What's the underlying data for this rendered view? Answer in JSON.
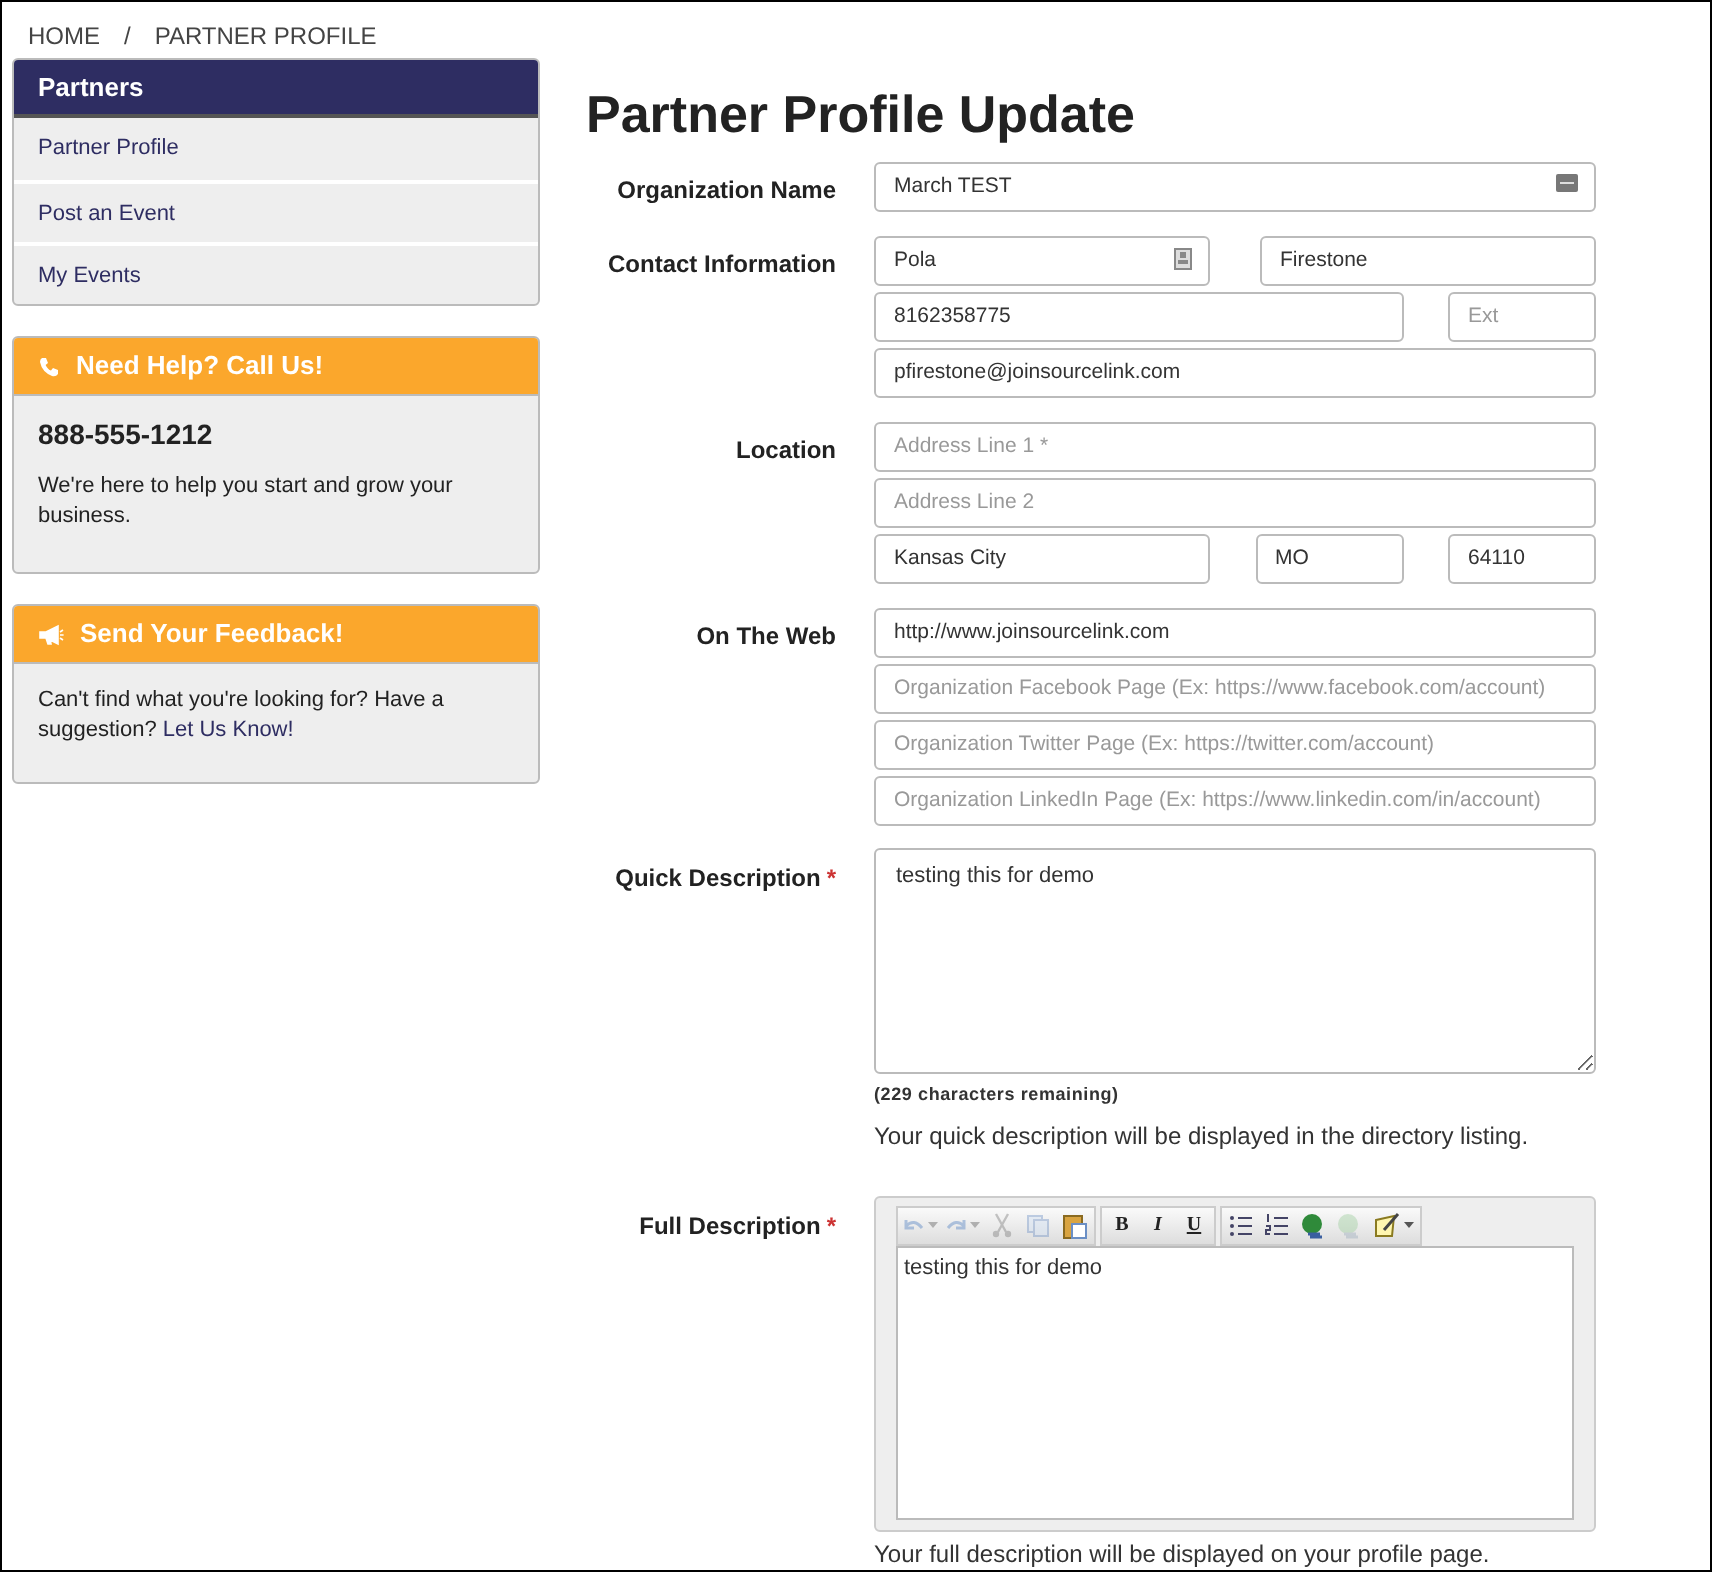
{
  "breadcrumb": {
    "separator": "/",
    "items": [
      "HOME",
      "PARTNER PROFILE"
    ]
  },
  "sidebar": {
    "title": "Partners",
    "items": [
      {
        "label": "Partner Profile"
      },
      {
        "label": "Post an Event"
      },
      {
        "label": "My Events"
      }
    ]
  },
  "help_panel": {
    "title": "Need Help? Call Us!",
    "phone": "888-555-1212",
    "text": "We're here to help you start and grow your business."
  },
  "feedback_panel": {
    "title": "Send Your Feedback!",
    "text": "Can't find what you're looking for? Have a suggestion?",
    "link": "Let Us Know!"
  },
  "page_title": "Partner Profile Update",
  "sections": [
    {
      "label": "Organization Name",
      "rows": [
        [
          {
            "kind": "full",
            "value": "March TEST"
          }
        ]
      ]
    },
    {
      "label": "Contact Information",
      "rows": [
        [
          {
            "kind": "half",
            "value": "Pola"
          },
          {
            "kind": "half",
            "value": "Firestone"
          }
        ],
        [
          {
            "kind": "wide",
            "value": "8162358775"
          },
          {
            "kind": "small",
            "placeholder": "Ext"
          }
        ],
        [
          {
            "kind": "full",
            "value": "pfirestone@joinsourcelink.com"
          }
        ]
      ]
    },
    {
      "label": "Location",
      "rows": [
        [
          {
            "kind": "full",
            "placeholder": "Address Line 1 *"
          }
        ],
        [
          {
            "kind": "full",
            "placeholder": "Address Line 2"
          }
        ],
        [
          {
            "kind": "half",
            "value": "Kansas City"
          },
          {
            "kind": "small",
            "value": "MO"
          },
          {
            "kind": "small",
            "value": "64110"
          }
        ]
      ]
    },
    {
      "label": "On The Web",
      "rows": [
        [
          {
            "kind": "full",
            "value": "http://www.joinsourcelink.com"
          }
        ],
        [
          {
            "kind": "full",
            "placeholder": "Organization Facebook Page (Ex: https://www.facebook.com/account)"
          }
        ],
        [
          {
            "kind": "full",
            "placeholder": "Organization Twitter Page (Ex: https://twitter.com/account)"
          }
        ],
        [
          {
            "kind": "full",
            "placeholder": "Organization LinkedIn Page (Ex: https://www.linkedin.com/in/account)"
          }
        ]
      ]
    }
  ],
  "quick_description": {
    "label": "Quick Description",
    "required_mark": "*",
    "value": "testing this for demo",
    "remaining": "(229 characters remaining)",
    "help": "Your quick description will be displayed in the directory listing."
  },
  "full_description": {
    "label": "Full Description",
    "required_mark": "*",
    "value": "testing this for demo",
    "help": "Your full description will be displayed on your profile page.",
    "toolbar": [
      [
        {
          "kind": "undo",
          "disabled": true
        },
        {
          "kind": "redo",
          "disabled": true
        },
        {
          "kind": "cut",
          "disabled": true
        },
        {
          "kind": "copy",
          "disabled": true
        },
        {
          "kind": "paste",
          "disabled": false
        }
      ],
      [
        {
          "kind": "text",
          "label": "B",
          "disabled": false
        },
        {
          "kind": "text",
          "label": "I",
          "disabled": false
        },
        {
          "kind": "text",
          "label": "U",
          "disabled": false
        }
      ],
      [
        {
          "kind": "bullets",
          "disabled": false
        },
        {
          "kind": "numbers",
          "disabled": false
        },
        {
          "kind": "link",
          "disabled": false
        },
        {
          "kind": "unlink",
          "disabled": true
        },
        {
          "kind": "format",
          "disabled": false
        }
      ]
    ]
  }
}
